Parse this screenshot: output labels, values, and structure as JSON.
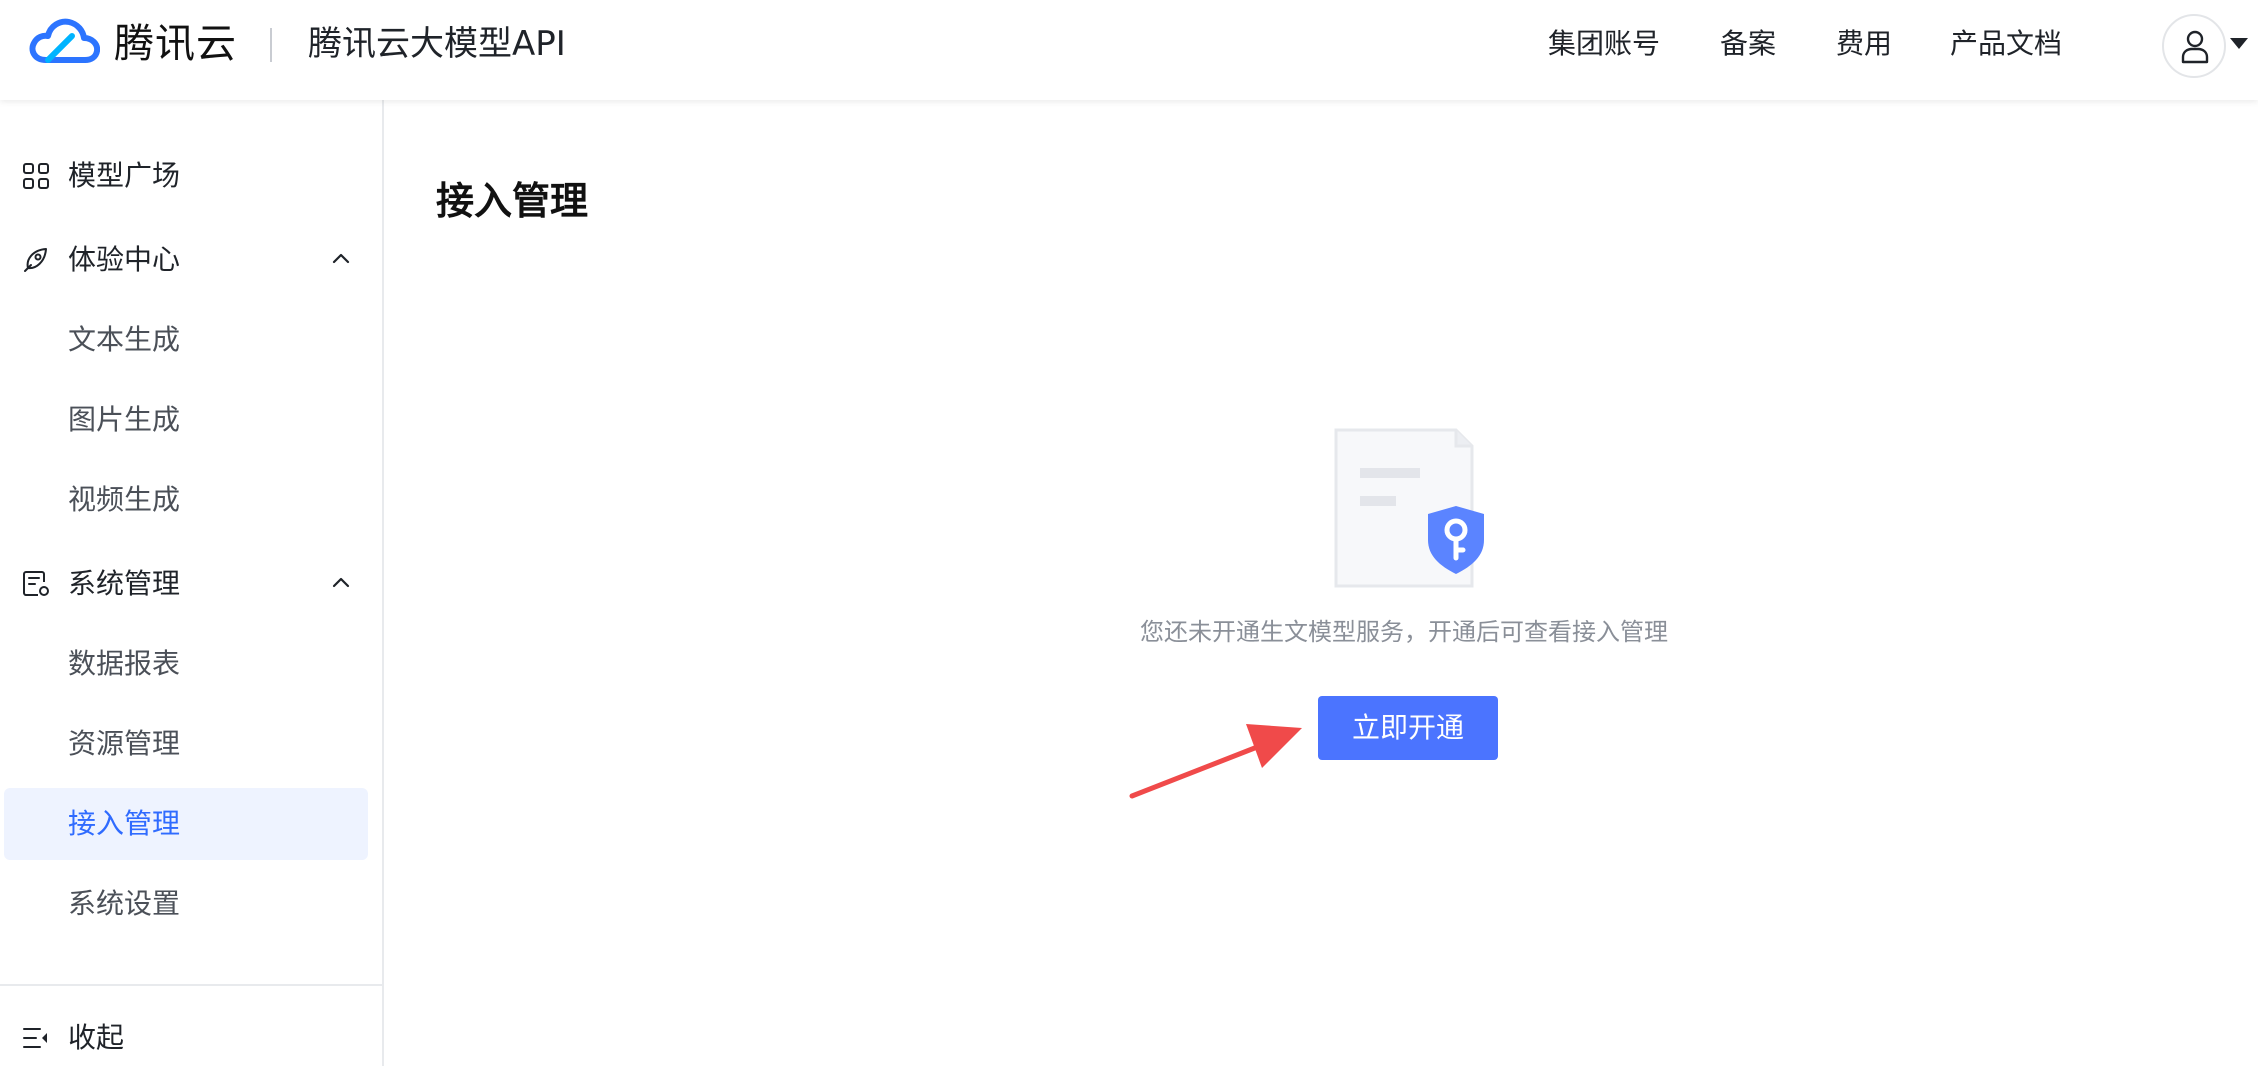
{
  "header": {
    "brand": "腾讯云",
    "product_title": "腾讯云大模型API",
    "nav": [
      "集团账号",
      "备案",
      "费用",
      "产品文档"
    ],
    "logo_icon": "tencent-cloud-logo",
    "avatar_icon": "user-icon"
  },
  "sidebar": {
    "items": [
      {
        "label": "模型广场",
        "icon": "grid-icon"
      },
      {
        "label": "体验中心",
        "icon": "rocket-icon",
        "expanded": true,
        "children": [
          "文本生成",
          "图片生成",
          "视频生成"
        ]
      },
      {
        "label": "系统管理",
        "icon": "system-settings-icon",
        "expanded": true,
        "children": [
          "数据报表",
          "资源管理",
          "接入管理",
          "系统设置"
        ],
        "active_child": "接入管理"
      }
    ],
    "collapse_label": "收起",
    "collapse_icon": "collapse-menu-icon"
  },
  "main": {
    "title": "接入管理",
    "empty_text": "您还未开通生文模型服务，开通后可查看接入管理",
    "activate_button": "立即开通",
    "illustration_icon": "document-shield-key-icon"
  },
  "colors": {
    "accent": "#4b74ff",
    "active_bg": "#eef3ff",
    "active_text": "#2f6bff",
    "annotation_arrow": "#f04a4a"
  }
}
